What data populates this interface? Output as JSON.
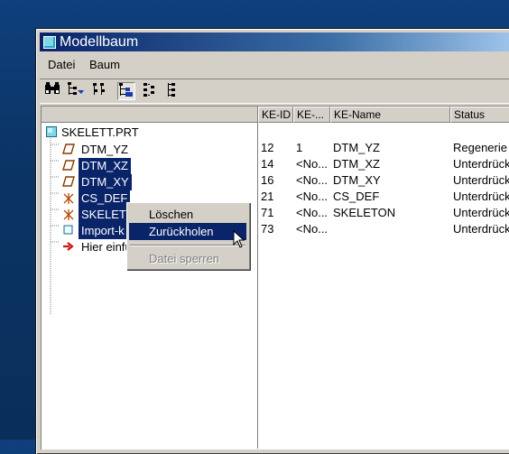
{
  "window": {
    "title": "Modellbaum"
  },
  "menu": {
    "items": [
      "Datei",
      "Baum"
    ]
  },
  "toolbar": {
    "icons": [
      "binoculars-icon",
      "tree-filter-icon",
      "columns-icon",
      "tree-selection-icon",
      "expand-tree-icon",
      "collapse-tree-icon"
    ]
  },
  "tree": {
    "root": "SKELETT.PRT",
    "items": [
      {
        "label": "DTM_YZ",
        "icon": "datum-plane-icon",
        "selected": false
      },
      {
        "label": "DTM_XZ",
        "icon": "datum-plane-icon",
        "selected": true
      },
      {
        "label": "DTM_XY",
        "icon": "datum-plane-icon",
        "selected": true
      },
      {
        "label": "CS_DEF",
        "icon": "coordinate-system-icon",
        "selected": true
      },
      {
        "label": "SKELET",
        "icon": "coordinate-system-icon",
        "selected": true
      },
      {
        "label": "Import-k",
        "icon": "import-feature-icon",
        "selected": true
      },
      {
        "label": "Hier einfü",
        "icon": "insert-here-arrow-icon",
        "selected": false
      }
    ]
  },
  "columns": [
    "KE-ID",
    "KE-...",
    "KE-Name",
    "Status"
  ],
  "rows": [
    [
      "12",
      "1",
      "DTM_YZ",
      "Regenerie"
    ],
    [
      "14",
      "<No...",
      "DTM_XZ",
      "Unterdrück"
    ],
    [
      "16",
      "<No...",
      "DTM_XY",
      "Unterdrück"
    ],
    [
      "21",
      "<No...",
      "CS_DEF",
      "Unterdrück"
    ],
    [
      "71",
      "<No...",
      "SKELETON",
      "Unterdrück"
    ],
    [
      "73",
      "<No...",
      "",
      "Unterdrück"
    ]
  ],
  "context_menu": {
    "items": [
      {
        "label": "Löschen",
        "state": "normal"
      },
      {
        "label": "Zurückholen",
        "state": "highlighted"
      },
      {
        "label": "Datei sperren",
        "state": "disabled"
      }
    ]
  },
  "colors": {
    "selection": "#0a246a",
    "face": "#d4d0c8",
    "desktop": "#0b3566"
  }
}
